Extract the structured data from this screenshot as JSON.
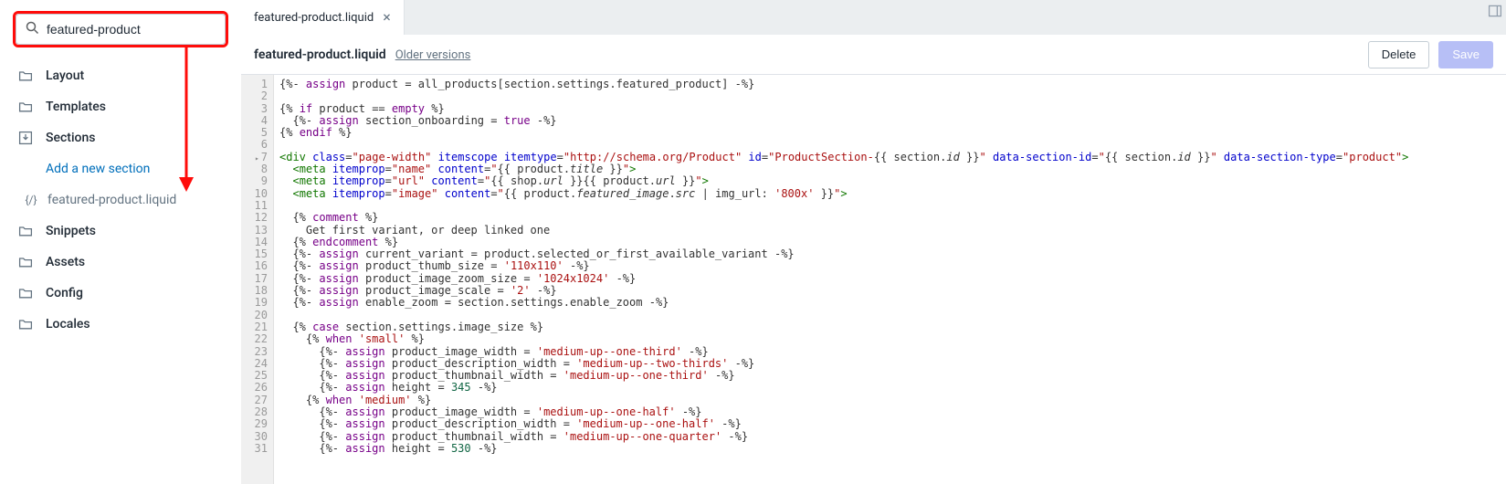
{
  "search": {
    "value": "featured-product"
  },
  "nav": {
    "layout": "Layout",
    "templates": "Templates",
    "sections": "Sections",
    "add_section": "Add a new section",
    "featured_product_file": "featured-product.liquid",
    "snippets": "Snippets",
    "assets": "Assets",
    "config": "Config",
    "locales": "Locales"
  },
  "tab": {
    "label": "featured-product.liquid"
  },
  "file": {
    "title": "featured-product.liquid",
    "older": "Older versions",
    "delete": "Delete",
    "save": "Save"
  },
  "gutter": [
    "1",
    "2",
    "3",
    "4",
    "5",
    "6",
    "7",
    "8",
    "9",
    "10",
    "11",
    "12",
    "13",
    "14",
    "15",
    "16",
    "17",
    "18",
    "19",
    "20",
    "21",
    "22",
    "23",
    "24",
    "25",
    "26",
    "27",
    "28",
    "29",
    "30",
    "31"
  ],
  "code": {
    "l1": "{%- assign product = all_products[section.settings.featured_product] -%}",
    "l2": "",
    "l3": "{% if product == empty %}",
    "l4": "  {%- assign section_onboarding = true -%}",
    "l5": "{% endif %}",
    "l6": "",
    "l7": "<div class=\"page-width\" itemscope itemtype=\"http://schema.org/Product\" id=\"ProductSection-{{ section.id }}\" data-section-id=\"{{ section.id }}\" data-section-type=\"product\">",
    "l8": "  <meta itemprop=\"name\" content=\"{{ product.title }}\">",
    "l9": "  <meta itemprop=\"url\" content=\"{{ shop.url }}{{ product.url }}\">",
    "l10": "  <meta itemprop=\"image\" content=\"{{ product.featured_image.src | img_url: '800x' }}\">",
    "l11": "",
    "l12": "  {% comment %}",
    "l13": "    Get first variant, or deep linked one",
    "l14": "  {% endcomment %}",
    "l15": "  {%- assign current_variant = product.selected_or_first_available_variant -%}",
    "l16": "  {%- assign product_thumb_size = '110x110' -%}",
    "l17": "  {%- assign product_image_zoom_size = '1024x1024' -%}",
    "l18": "  {%- assign product_image_scale = '2' -%}",
    "l19": "  {%- assign enable_zoom = section.settings.enable_zoom -%}",
    "l20": "",
    "l21": "  {% case section.settings.image_size %}",
    "l22": "    {% when 'small' %}",
    "l23": "      {%- assign product_image_width = 'medium-up--one-third' -%}",
    "l24": "      {%- assign product_description_width = 'medium-up--two-thirds' -%}",
    "l25": "      {%- assign product_thumbnail_width = 'medium-up--one-third' -%}",
    "l26": "      {%- assign height = 345 -%}",
    "l27": "    {% when 'medium' %}",
    "l28": "      {%- assign product_image_width = 'medium-up--one-half' -%}",
    "l29": "      {%- assign product_description_width = 'medium-up--one-half' -%}",
    "l30": "      {%- assign product_thumbnail_width = 'medium-up--one-quarter' -%}",
    "l31": "      {%- assign height = 530 -%}"
  }
}
